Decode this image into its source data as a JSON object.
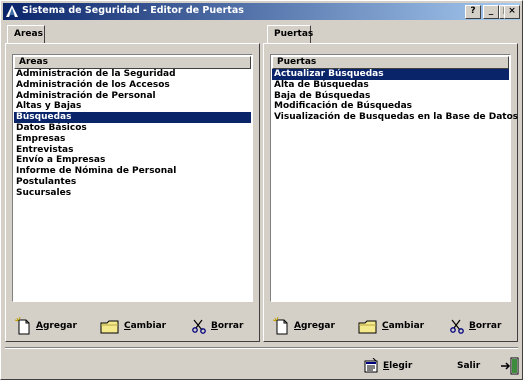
{
  "window": {
    "title": "Sistema de Seguridad - Editor de Puertas",
    "controls": {
      "help": "?",
      "minimize": "_",
      "maximize": "□",
      "close": "×"
    }
  },
  "areas": {
    "tab_label": "Areas",
    "column_header": "Areas",
    "items": [
      {
        "label": "Administración de la Seguridad",
        "selected": false
      },
      {
        "label": "Administración de los Accesos",
        "selected": false
      },
      {
        "label": "Administración de Personal",
        "selected": false
      },
      {
        "label": "Altas y Bajas",
        "selected": false
      },
      {
        "label": "Búsquedas",
        "selected": true
      },
      {
        "label": "Datos Básicos",
        "selected": false
      },
      {
        "label": "Empresas",
        "selected": false
      },
      {
        "label": "Entrevistas",
        "selected": false
      },
      {
        "label": "Envío a Empresas",
        "selected": false
      },
      {
        "label": "Informe de Nómina de Personal",
        "selected": false
      },
      {
        "label": "Postulantes",
        "selected": false
      },
      {
        "label": "Sucursales",
        "selected": false
      }
    ],
    "actions": {
      "add": "Agregar",
      "change": "Cambiar",
      "delete": "Borrar"
    }
  },
  "puertas": {
    "tab_label": "Puertas",
    "column_header": "Puertas",
    "items": [
      {
        "label": "Actualizar Búsquedas",
        "selected": true
      },
      {
        "label": "Alta de Búsquedas",
        "selected": false
      },
      {
        "label": "Baja de Búsquedas",
        "selected": false
      },
      {
        "label": "Modificación de Búsquedas",
        "selected": false
      },
      {
        "label": "Visualización de Busquedas en la Base de Datos",
        "selected": false
      }
    ],
    "actions": {
      "add": "Agregar",
      "change": "Cambiar",
      "delete": "Borrar"
    }
  },
  "footer": {
    "choose_label": "Elegir",
    "exit_label": "Salir"
  },
  "colors": {
    "selection": "#0a246a",
    "face": "#d4d0c8",
    "title_start": "#0a246a",
    "title_end": "#a6caf0"
  }
}
